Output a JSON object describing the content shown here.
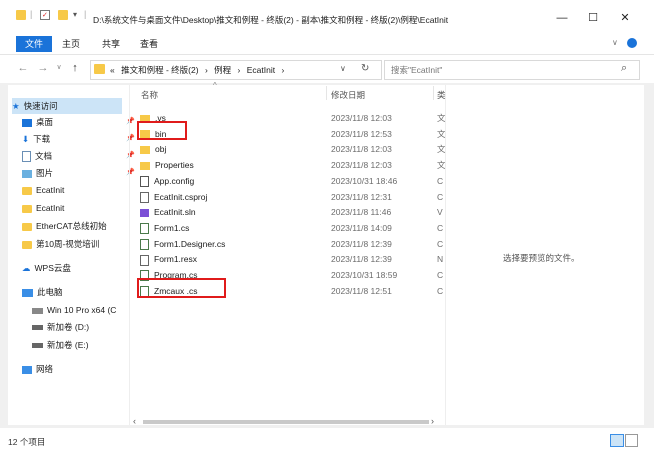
{
  "titlebar": {
    "path": "D:\\系统文件与桌面文件\\Desktop\\推文和例程 - 终版(2) - 副本\\推文和例程 - 终版(2)\\例程\\EcatInit",
    "minimize": "—",
    "maximize": "☐",
    "close": "✕"
  },
  "ribbon": {
    "tabs": [
      "文件",
      "主页",
      "共享",
      "查看"
    ],
    "collapse": "∨"
  },
  "nav": {
    "back": "←",
    "forward": "→",
    "recent": "∨",
    "up": "↑",
    "breadcrumb": [
      "«",
      "推文和例程 - 终版(2)",
      "›",
      "例程",
      "›",
      "EcatInit",
      "›"
    ],
    "dropdown": "∨",
    "refresh": "↻",
    "search_placeholder": "搜索\"EcatInit\"",
    "search_icon": "⌕"
  },
  "sidebar": {
    "quick_access": "快速访问",
    "items": [
      {
        "label": "桌面",
        "icon": "desktop-icon"
      },
      {
        "label": "下载",
        "icon": "download-icon"
      },
      {
        "label": "文档",
        "icon": "document-icon"
      },
      {
        "label": "图片",
        "icon": "picture-icon"
      },
      {
        "label": "EcatInit",
        "icon": "folder-icon"
      },
      {
        "label": "EcatInit",
        "icon": "folder-icon"
      },
      {
        "label": "EtherCAT总线初始",
        "icon": "folder-icon"
      },
      {
        "label": "第10周-视觉培训",
        "icon": "folder-icon"
      }
    ],
    "wps": "WPS云盘",
    "this_pc": "此电脑",
    "drives": [
      "Win 10 Pro x64 (C",
      "新加卷 (D:)",
      "新加卷 (E:)"
    ],
    "network": "网络"
  },
  "columns": {
    "name": "名称",
    "date": "修改日期",
    "type": "类"
  },
  "files": [
    {
      "name": ".vs",
      "date": "2023/11/8 12:03",
      "type": "文",
      "kind": "folder"
    },
    {
      "name": "bin",
      "date": "2023/11/8 12:53",
      "type": "文",
      "kind": "folder"
    },
    {
      "name": "obj",
      "date": "2023/11/8 12:03",
      "type": "文",
      "kind": "folder"
    },
    {
      "name": "Properties",
      "date": "2023/11/8 12:03",
      "type": "文",
      "kind": "folder"
    },
    {
      "name": "App.config",
      "date": "2023/10/31 18:46",
      "type": "C",
      "kind": "config"
    },
    {
      "name": "EcatInit.csproj",
      "date": "2023/11/8 12:31",
      "type": "C",
      "kind": "file"
    },
    {
      "name": "EcatInit.sln",
      "date": "2023/11/8 11:46",
      "type": "V",
      "kind": "sln"
    },
    {
      "name": "Form1.cs",
      "date": "2023/11/8 14:09",
      "type": "C",
      "kind": "cs"
    },
    {
      "name": "Form1.Designer.cs",
      "date": "2023/11/8 12:39",
      "type": "C",
      "kind": "cs"
    },
    {
      "name": "Form1.resx",
      "date": "2023/11/8 12:39",
      "type": "N",
      "kind": "file"
    },
    {
      "name": "Program.cs",
      "date": "2023/10/31 18:59",
      "type": "C",
      "kind": "cs"
    },
    {
      "name": "Zmcaux .cs",
      "date": "2023/11/8 12:51",
      "type": "C",
      "kind": "cs"
    }
  ],
  "preview_text": "选择要预览的文件。",
  "status": {
    "count": "12 个项目"
  },
  "colors": {
    "accent": "#1a73d9",
    "highlight": "#e01b1b",
    "folder": "#f7c948"
  }
}
